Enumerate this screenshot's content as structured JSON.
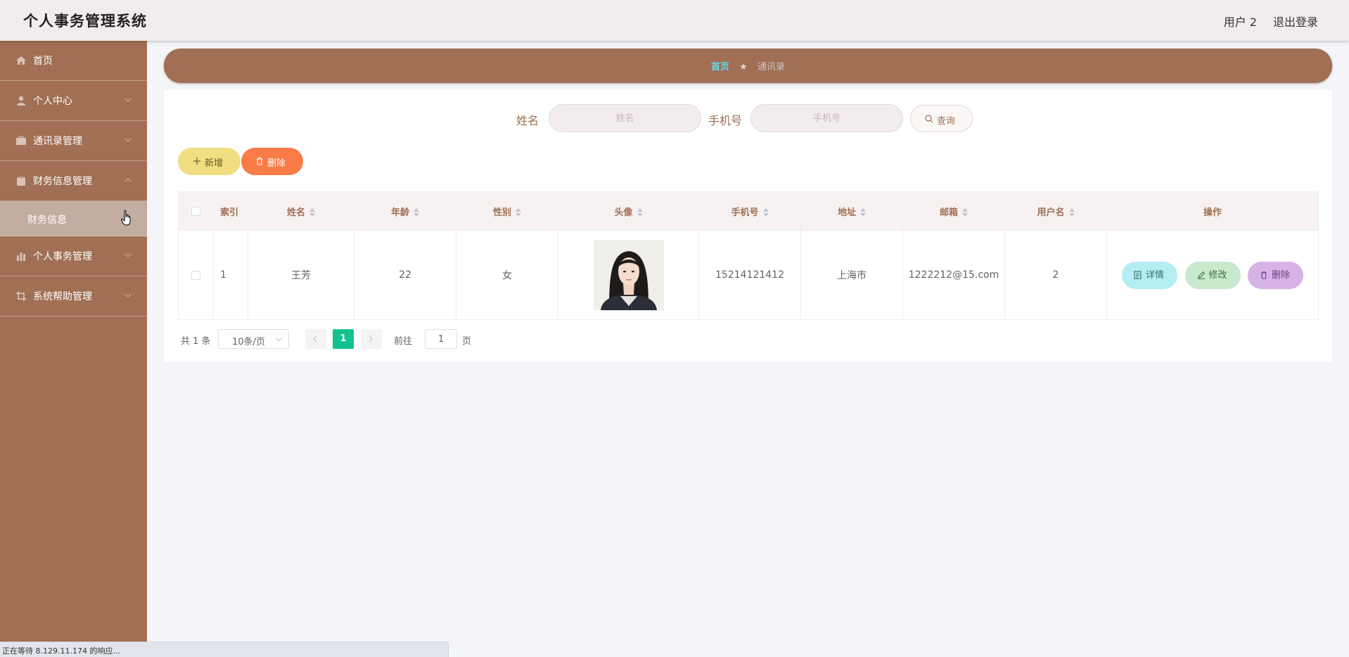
{
  "header": {
    "title": "个人事务管理系统",
    "user": "用户 2",
    "logout": "退出登录"
  },
  "sidebar": {
    "items": [
      {
        "label": "首页",
        "icon": "home-icon"
      },
      {
        "label": "个人中心",
        "icon": "user-icon"
      },
      {
        "label": "通讯录管理",
        "icon": "briefcase-icon"
      },
      {
        "label": "财务信息管理",
        "icon": "clipboard-icon",
        "expanded": true
      },
      {
        "label": "个人事务管理",
        "icon": "chart-icon"
      },
      {
        "label": "系统帮助管理",
        "icon": "crop-icon"
      }
    ],
    "submenu": [
      {
        "label": "财务信息"
      }
    ]
  },
  "breadcrumb": {
    "home": "首页",
    "current": "通讯录",
    "separator": "★"
  },
  "search": {
    "name_label": "姓名",
    "name_placeholder": "姓名",
    "phone_label": "手机号",
    "phone_placeholder": "手机号",
    "query_button": "查询"
  },
  "actions": {
    "add": "新增",
    "delete": "删除"
  },
  "table": {
    "columns": [
      "索引",
      "姓名",
      "年龄",
      "性别",
      "头像",
      "手机号",
      "地址",
      "邮箱",
      "用户名",
      "操作"
    ],
    "rows": [
      {
        "index": "1",
        "name": "王芳",
        "age": "22",
        "gender": "女",
        "phone": "15214121412",
        "address": "上海市",
        "email": "1222212@15.com",
        "username": "2"
      }
    ],
    "row_actions": {
      "detail": "详情",
      "edit": "修改",
      "delete": "删除"
    }
  },
  "pagination": {
    "total": "共 1 条",
    "page_size": "10条/页",
    "current_page": "1",
    "goto_label": "前往",
    "goto_value": "1",
    "page_suffix": "页"
  },
  "statusbar": {
    "text": "正在等待 8.129.11.174 的响应..."
  },
  "colors": {
    "primary": "#a06f54",
    "header_bg": "#f3ecec",
    "page_active": "#13c28f",
    "add_btn": "#f0de80",
    "delete_btn": "#f97b47"
  }
}
